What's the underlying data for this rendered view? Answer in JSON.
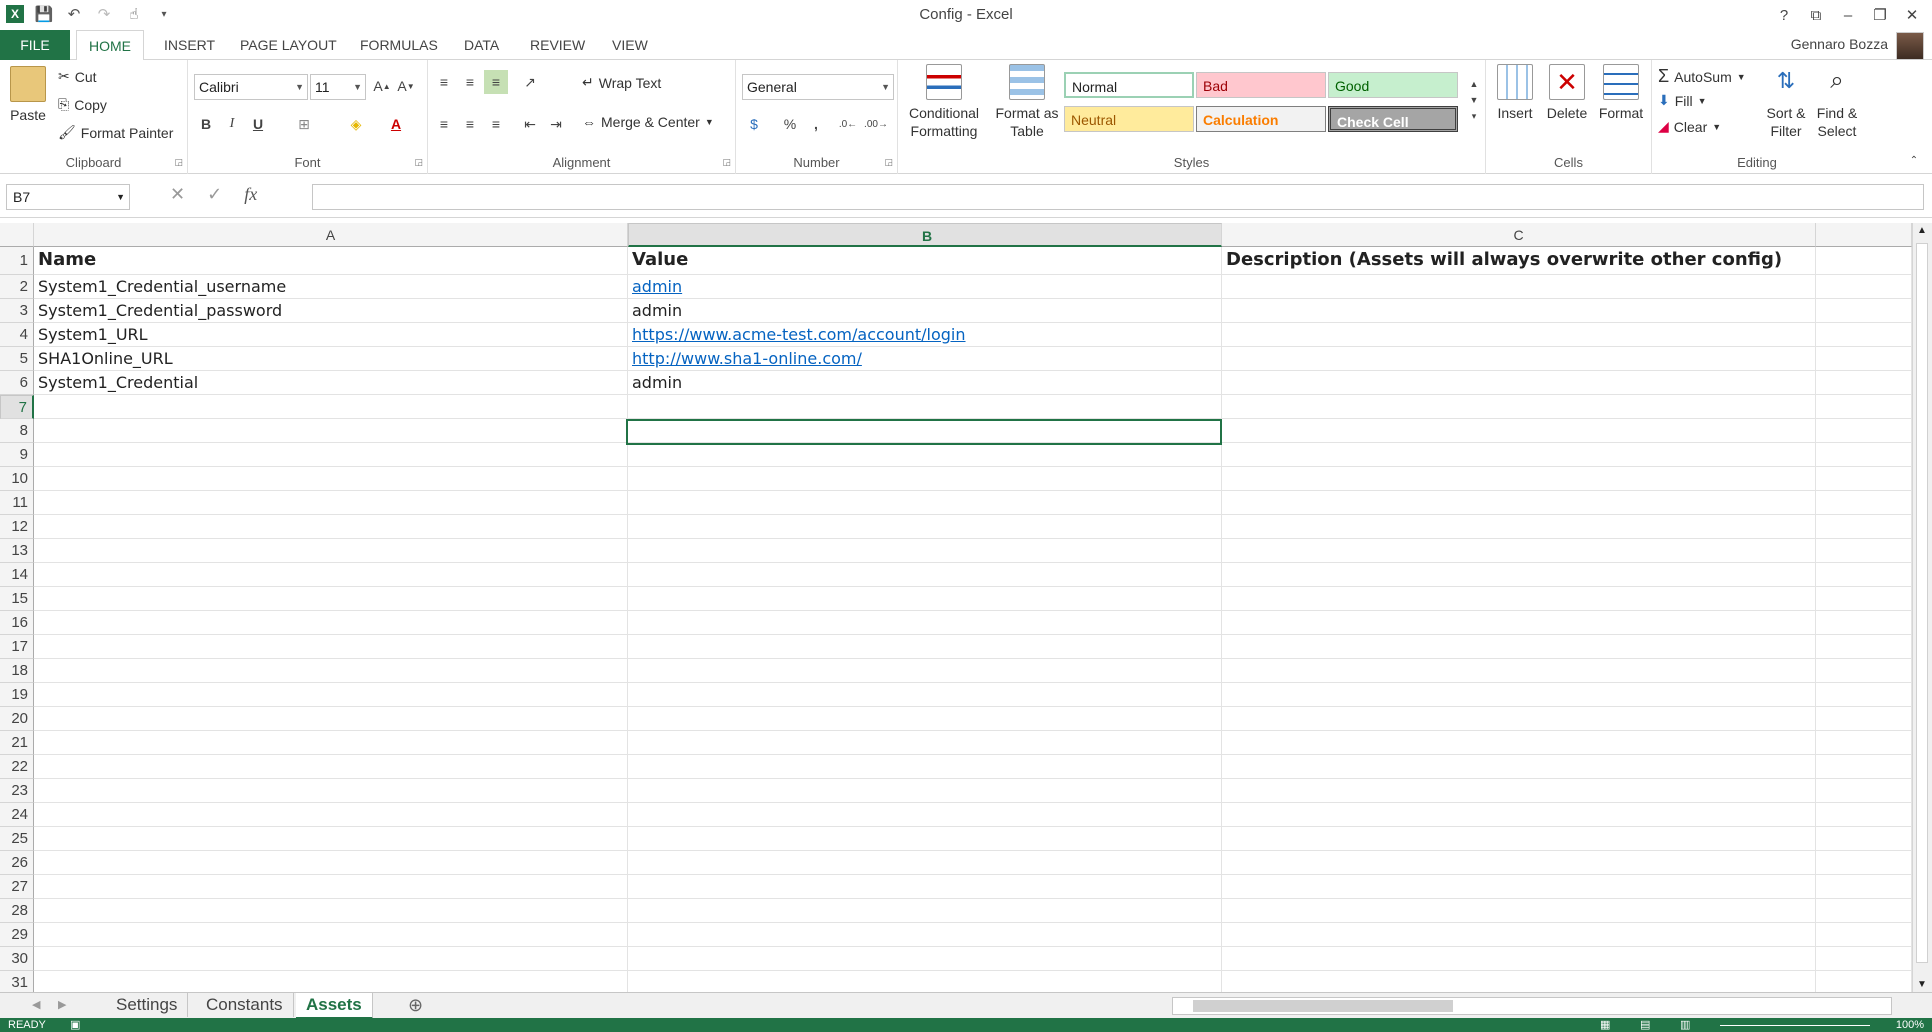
{
  "app": {
    "title": "Config - Excel",
    "user": "Gennaro Bozza"
  },
  "tabs": [
    "FILE",
    "HOME",
    "INSERT",
    "PAGE LAYOUT",
    "FORMULAS",
    "DATA",
    "REVIEW",
    "VIEW"
  ],
  "ribbon": {
    "clipboard": {
      "paste": "Paste",
      "cut": "Cut",
      "copy": "Copy",
      "format_painter": "Format Painter",
      "label": "Clipboard"
    },
    "font": {
      "name": "Calibri",
      "size": "11",
      "label": "Font",
      "bold": "B",
      "italic": "I",
      "underline": "U"
    },
    "alignment": {
      "wrap": "Wrap Text",
      "merge": "Merge & Center",
      "label": "Alignment"
    },
    "number": {
      "format": "General",
      "label": "Number",
      "percent": "%",
      "comma": ","
    },
    "styles": {
      "conditional": "Conditional Formatting",
      "format_table": "Format as Table",
      "label": "Styles",
      "normal": "Normal",
      "bad": "Bad",
      "good": "Good",
      "neutral": "Neutral",
      "calculation": "Calculation",
      "check": "Check Cell"
    },
    "cells": {
      "insert": "Insert",
      "delete": "Delete",
      "format": "Format",
      "label": "Cells"
    },
    "editing": {
      "autosum": "AutoSum",
      "fill": "Fill",
      "clear": "Clear",
      "sort": "Sort & Filter",
      "find": "Find & Select",
      "label": "Editing"
    }
  },
  "formula_bar": {
    "name_box": "B7",
    "fx": "fx",
    "value": ""
  },
  "columns": [
    "A",
    "B",
    "C"
  ],
  "rows": [
    {
      "n": "1",
      "a": "Name",
      "b": "Value",
      "c": "Description (Assets will always overwrite other config)"
    },
    {
      "n": "2",
      "a": "System1_Credential_username",
      "b": "admin",
      "c": ""
    },
    {
      "n": "3",
      "a": "System1_Credential_password",
      "b": "admin",
      "c": ""
    },
    {
      "n": "4",
      "a": "System1_URL",
      "b": "https://www.acme-test.com/account/login",
      "c": ""
    },
    {
      "n": "5",
      "a": "SHA1Online_URL",
      "b": "http://www.sha1-online.com/",
      "c": ""
    },
    {
      "n": "6",
      "a": "System1_Credential",
      "b": "admin",
      "c": ""
    }
  ],
  "empty_rows": [
    "7",
    "8",
    "9",
    "10",
    "11",
    "12",
    "13",
    "14",
    "15",
    "16",
    "17",
    "18",
    "19",
    "20",
    "21",
    "22",
    "23",
    "24",
    "25",
    "26",
    "27",
    "28",
    "29",
    "30",
    "31"
  ],
  "sheets": [
    "Settings",
    "Constants",
    "Assets"
  ],
  "status": {
    "ready": "READY",
    "zoom": "100%"
  }
}
